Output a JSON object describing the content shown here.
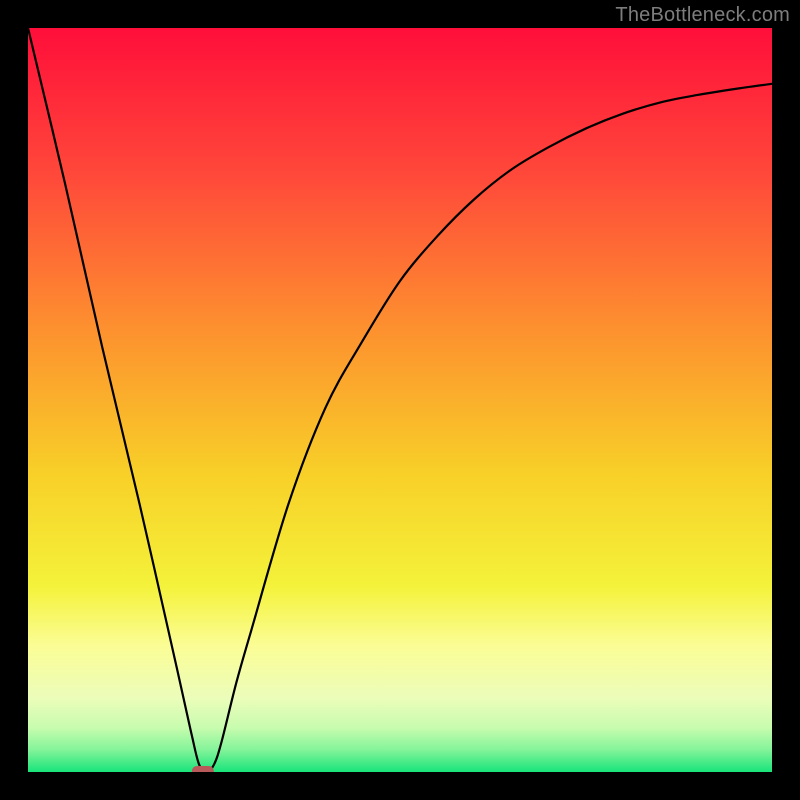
{
  "attribution": "TheBottleneck.com",
  "chart_data": {
    "type": "line",
    "title": "",
    "xlabel": "",
    "ylabel": "",
    "xlim": [
      0,
      100
    ],
    "ylim": [
      0,
      100
    ],
    "grid": false,
    "series": [
      {
        "name": "curve",
        "x": [
          0,
          5,
          10,
          15,
          20,
          22,
          23,
          24,
          25,
          26,
          28,
          30,
          35,
          40,
          45,
          50,
          55,
          60,
          65,
          70,
          75,
          80,
          85,
          90,
          95,
          100
        ],
        "y": [
          100,
          79,
          57,
          36,
          14,
          5,
          1,
          0,
          1,
          4,
          12,
          19,
          36,
          49,
          58,
          66,
          72,
          77,
          81,
          84,
          86.5,
          88.5,
          90,
          91,
          91.8,
          92.5
        ]
      }
    ],
    "marker": {
      "x": 23.5,
      "y": 0,
      "color": "#b85a5a"
    },
    "background_gradient_stops": [
      {
        "pos": 0.0,
        "color": "#ff0e3a"
      },
      {
        "pos": 0.2,
        "color": "#ff493a"
      },
      {
        "pos": 0.4,
        "color": "#fd8f2f"
      },
      {
        "pos": 0.6,
        "color": "#f8d028"
      },
      {
        "pos": 0.75,
        "color": "#f4f23a"
      },
      {
        "pos": 0.83,
        "color": "#fbfd95"
      },
      {
        "pos": 0.9,
        "color": "#ecfdba"
      },
      {
        "pos": 0.94,
        "color": "#c8fcae"
      },
      {
        "pos": 0.97,
        "color": "#84f49a"
      },
      {
        "pos": 1.0,
        "color": "#18e47a"
      }
    ]
  }
}
